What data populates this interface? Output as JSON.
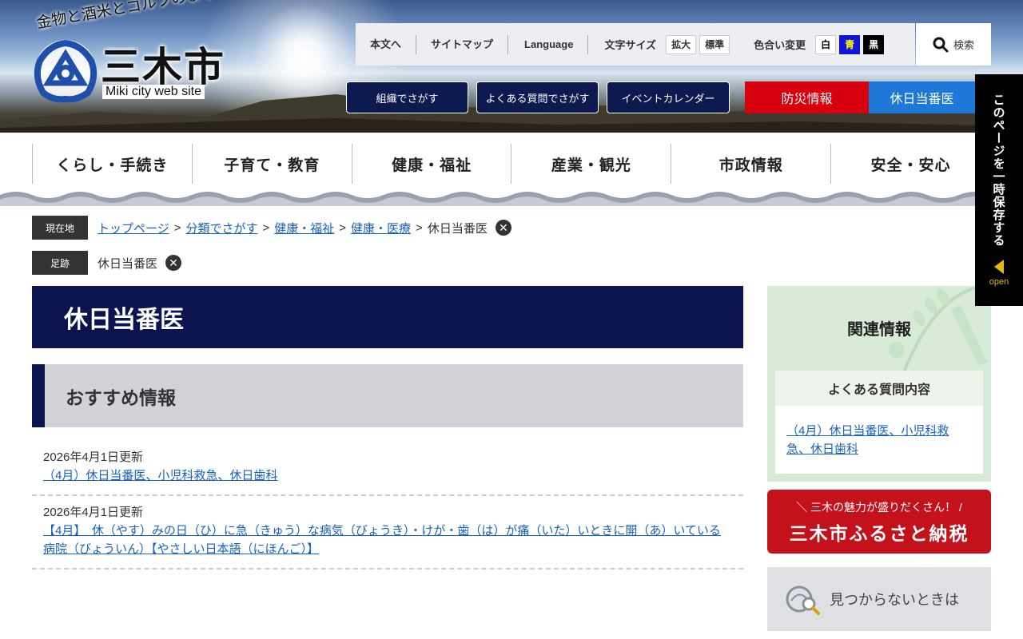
{
  "header": {
    "tagline": "金物と酒米とゴルフのまち",
    "site_name": "三木市",
    "site_sub": "Miki city web site"
  },
  "utility": {
    "links": [
      "本文へ",
      "サイトマップ",
      "Language"
    ],
    "font_size_label": "文字サイズ",
    "font_size_options": [
      "拡大",
      "標準"
    ],
    "color_label": "色合い変更",
    "color_options": [
      {
        "label": "白",
        "bg": "#ffffff",
        "fg": "#000000"
      },
      {
        "label": "青",
        "bg": "#1414d8",
        "fg": "#ffff00"
      },
      {
        "label": "黒",
        "bg": "#000000",
        "fg": "#ffffff"
      }
    ],
    "search_label": "検索"
  },
  "quick_nav": [
    "組織でさがす",
    "よくある質問でさがす",
    "イベントカレンダー"
  ],
  "disaster_label": "防災情報",
  "holiday_label": "休日当番医",
  "global_nav": [
    "くらし・手続き",
    "子育て・教育",
    "健康・福祉",
    "産業・観光",
    "市政情報",
    "安全・安心"
  ],
  "breadcrumb": {
    "label": "現在地",
    "links": [
      "トップページ",
      "分類でさがす",
      "健康・福祉",
      "健康・医療"
    ],
    "current": "休日当番医"
  },
  "footprint": {
    "label": "足跡",
    "item": "休日当番医"
  },
  "page_title": "休日当番医",
  "recommended": {
    "heading": "おすすめ情報",
    "items": [
      {
        "date": "2026年4月1日更新",
        "title": "（4月）休日当番医、小児科救急、休日歯科"
      },
      {
        "date": "2026年4月1日更新",
        "title": "【4月】　休（やす）みの日（ひ）に急（きゅう）な病気（びょうき）・けが・歯（は）が痛（いた）いときに開（あ）いている病院（びょういん）【やさしい日本語（にほんご）】"
      }
    ]
  },
  "sidebar": {
    "related_title": "関連情報",
    "faq_heading": "よくある質問内容",
    "faq_link": "（4月）休日当番医、小児科救急、休日歯科",
    "furusato_sub": "＼ 三木の魅力が盛りだくさん！ /",
    "furusato_main": "三木市ふるさと納税",
    "notfound": "見つからないときは"
  },
  "side_tab": {
    "text": "このページを一時保存する",
    "open": "open"
  },
  "colors": {
    "navy": "#0c1450",
    "disaster_red": "#d7000f",
    "holiday_blue": "#1e78d7",
    "link_blue": "#1761c4",
    "related_green": "#d7ebd6"
  }
}
